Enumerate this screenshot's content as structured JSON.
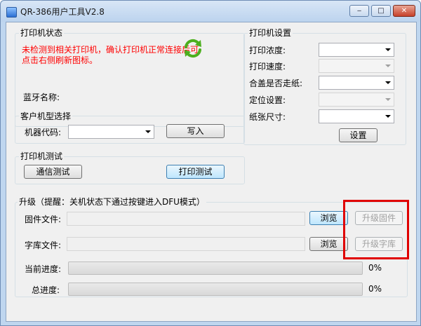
{
  "window": {
    "title": "QR-386用户工具V2.8",
    "minimize_glyph": "‒",
    "maximize_glyph": "□",
    "close_glyph": "✕"
  },
  "printer_status": {
    "group_title": "打印机状态",
    "message": "未检测到相关打印机，确认打印机正常连接后可点击右侧刷新图标。",
    "bluetooth_label": "蓝牙名称:",
    "refresh_icon": "refresh-icon",
    "message_color": "#ff0000",
    "icon_color": "#4caf1e"
  },
  "model_select": {
    "group_title": "客户机型选择",
    "code_label": "机器代码:",
    "code_value": "",
    "write_button": "写入"
  },
  "printer_test": {
    "group_title": "打印机测试",
    "comm_test_button": "通信测试",
    "print_test_button": "打印测试"
  },
  "printer_settings": {
    "group_title": "打印机设置",
    "rows": [
      {
        "label": "打印浓度:",
        "value": "",
        "enabled": true
      },
      {
        "label": "打印速度:",
        "value": "",
        "enabled": false
      },
      {
        "label": "合盖是否走纸:",
        "value": "",
        "enabled": true
      },
      {
        "label": "定位设置:",
        "value": "",
        "enabled": false
      },
      {
        "label": "纸张尺寸:",
        "value": "",
        "enabled": true
      }
    ],
    "set_button": "设置"
  },
  "upgrade": {
    "group_title": "升级（提醒：关机状态下通过按键进入DFU模式）",
    "firmware_label": "固件文件:",
    "firmware_path": "",
    "font_label": "字库文件:",
    "font_path": "",
    "browse_button": "浏览",
    "upgrade_firmware_button": "升级固件",
    "upgrade_font_button": "升级字库",
    "current_progress_label": "当前进度:",
    "current_progress_value": "0%",
    "current_progress": 0,
    "total_progress_label": "总进度:",
    "total_progress_value": "0%",
    "total_progress": 0,
    "highlight_color": "#e00000"
  }
}
